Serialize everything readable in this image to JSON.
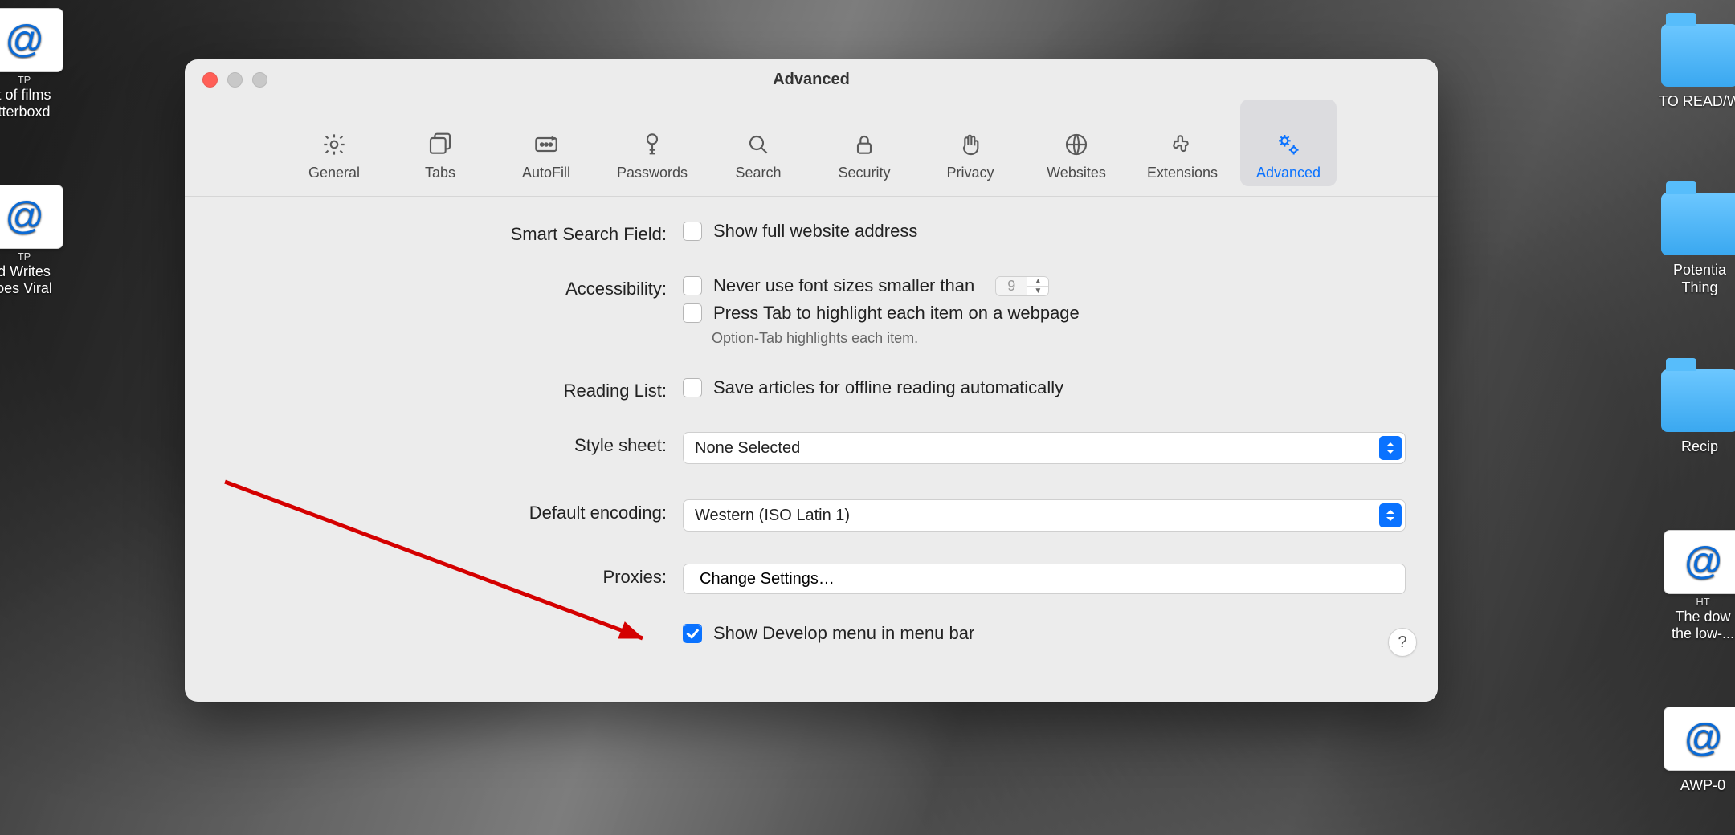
{
  "window": {
    "title": "Advanced"
  },
  "toolbar": {
    "items": [
      {
        "id": "general",
        "label": "General"
      },
      {
        "id": "tabs",
        "label": "Tabs"
      },
      {
        "id": "autofill",
        "label": "AutoFill"
      },
      {
        "id": "passwords",
        "label": "Passwords"
      },
      {
        "id": "search",
        "label": "Search"
      },
      {
        "id": "security",
        "label": "Security"
      },
      {
        "id": "privacy",
        "label": "Privacy"
      },
      {
        "id": "websites",
        "label": "Websites"
      },
      {
        "id": "extensions",
        "label": "Extensions"
      },
      {
        "id": "advanced",
        "label": "Advanced",
        "selected": true
      }
    ]
  },
  "sections": {
    "smart_search": {
      "label": "Smart Search Field:",
      "show_full_address": {
        "checked": false,
        "label": "Show full website address"
      }
    },
    "accessibility": {
      "label": "Accessibility:",
      "min_font": {
        "checked": false,
        "label": "Never use font sizes smaller than",
        "value": "9"
      },
      "press_tab": {
        "checked": false,
        "label": "Press Tab to highlight each item on a webpage"
      },
      "note": "Option-Tab highlights each item."
    },
    "reading_list": {
      "label": "Reading List:",
      "save_offline": {
        "checked": false,
        "label": "Save articles for offline reading automatically"
      }
    },
    "style_sheet": {
      "label": "Style sheet:",
      "value": "None Selected"
    },
    "default_encoding": {
      "label": "Default encoding:",
      "value": "Western (ISO Latin 1)"
    },
    "proxies": {
      "label": "Proxies:",
      "button": "Change Settings…"
    },
    "develop": {
      "checked": true,
      "label": "Show Develop menu in menu bar"
    }
  },
  "help_button": "?",
  "desktop": {
    "left": [
      {
        "type": "webloc",
        "ext": "TP",
        "label_1": "t of films",
        "label_2": "tterboxd"
      },
      {
        "type": "webloc",
        "ext": "TP",
        "label_1": "d Writes",
        "label_2": "oes Viral"
      }
    ],
    "right": [
      {
        "type": "folder",
        "label": "TO READ/W"
      },
      {
        "type": "folder",
        "label_1": "Potentia",
        "label_2": "Thing"
      },
      {
        "type": "folder",
        "label": "Recip"
      },
      {
        "type": "webloc",
        "ext": "HT",
        "label_1": "The dow",
        "label_2": "the low-..."
      },
      {
        "type": "webloc",
        "ext": "",
        "label": "AWP-0"
      }
    ]
  }
}
